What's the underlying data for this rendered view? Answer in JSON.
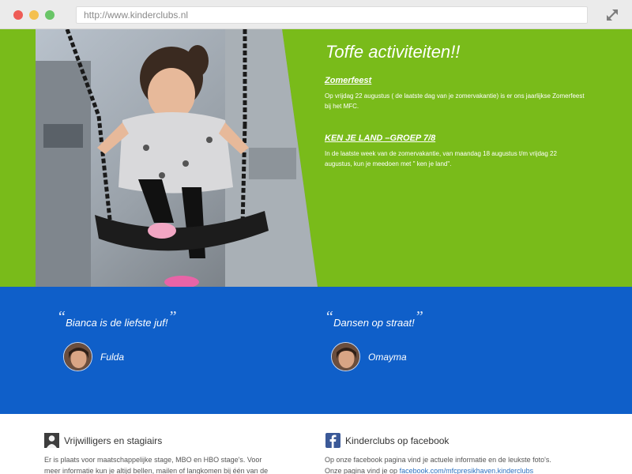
{
  "browser": {
    "url": "http://www.kinderclubs.nl"
  },
  "activities": {
    "heading": "Toffe activiteiten!!",
    "items": [
      {
        "title": "Zomerfeest",
        "text": "Op vrijdag 22 augustus ( de laatste dag van je zomervakantie) is er ons jaarlijkse Zomerfeest bij het MFC."
      },
      {
        "title": "KEN JE LAND –GROEP 7/8",
        "text": "In de laatste week van de zomervakantie, van maandag 18 augustus t/m vrijdag 22 augustus, kun je meedoen met \" ken je land\"."
      }
    ]
  },
  "testimonials": [
    {
      "quote": "Bianca is de liefste juf!",
      "name": "Fulda"
    },
    {
      "quote": "Dansen op straat!",
      "name": "Omayma"
    }
  ],
  "footer": {
    "volunteers": {
      "title": "Vrijwilligers en stagiairs",
      "text": "Er is plaats voor maatschappelijke stage, MBO en HBO stage's. Voor meer informatie kun je altijd bellen, mailen of langkomen bij één van de"
    },
    "facebook": {
      "title": "Kinderclubs op facebook",
      "text": "Op onze facebook pagina vind je actuele informatie en de leukste foto's.",
      "text2_prefix": "Onze pagina vind je op",
      "link": "facebook.com/mfcpresikhaven.kinderclubs"
    }
  },
  "colors": {
    "green": "#79bb1a",
    "blue": "#0f5fc9",
    "link": "#2a6fbf"
  }
}
